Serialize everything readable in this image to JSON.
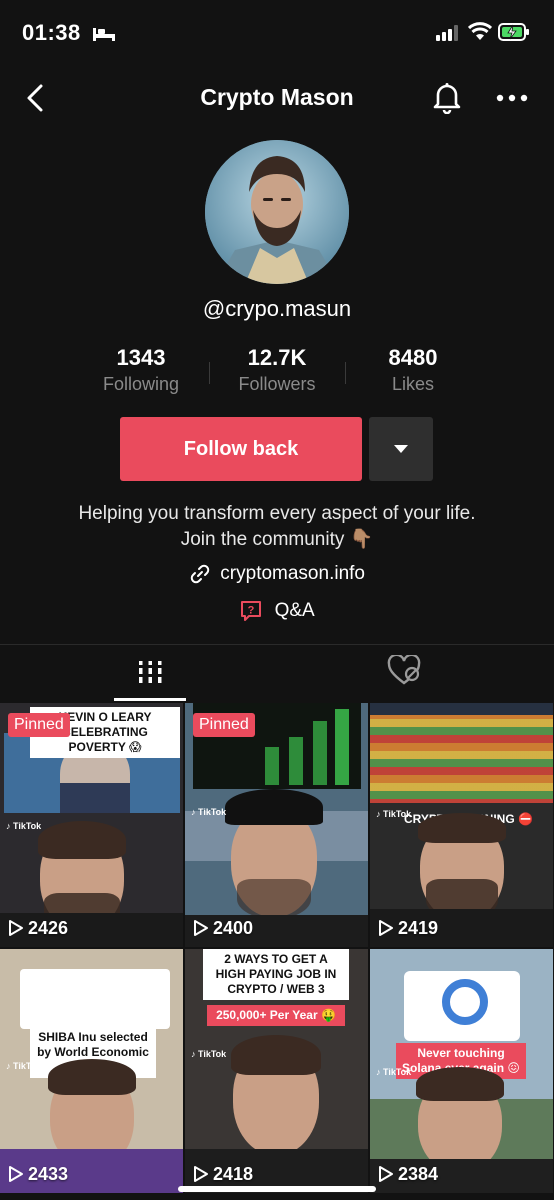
{
  "status_bar": {
    "time": "01:38"
  },
  "nav": {
    "title": "Crypto Mason"
  },
  "profile": {
    "handle": "@crypo.masun",
    "stats": [
      {
        "value": "1343",
        "label": "Following"
      },
      {
        "value": "12.7K",
        "label": "Followers"
      },
      {
        "value": "8480",
        "label": "Likes"
      }
    ],
    "follow_label": "Follow back",
    "bio_line1": "Helping you transform every aspect of your life.",
    "bio_line2": "Join the community 👇🏽",
    "link": "cryptomason.info",
    "qa": "Q&A"
  },
  "videos": [
    {
      "views": "2426",
      "pinned": "Pinned",
      "caption": "KEVIN O LEARY CELEBRATING POVERTY 😱"
    },
    {
      "views": "2400",
      "pinned": "Pinned",
      "caption": ""
    },
    {
      "views": "2419",
      "pinned": "",
      "caption": "CRYPTO WARNING ⛔"
    },
    {
      "views": "2433",
      "pinned": "",
      "caption": "SHIBA Inu selected by World Economic Forum..."
    },
    {
      "views": "2418",
      "pinned": "",
      "caption": "2 WAYS TO GET A HIGH PAYING JOB IN CRYPTO / WEB 3",
      "caption2": "250,000+ Per Year 🤑"
    },
    {
      "views": "2384",
      "pinned": "",
      "caption": "Never touching Solana ever again 😖"
    }
  ],
  "colors": {
    "accent": "#ea4b5d",
    "background": "#121212",
    "secondary_text": "#8a8a8a"
  }
}
